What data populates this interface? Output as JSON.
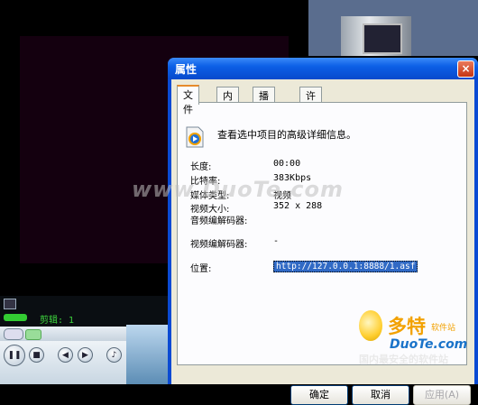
{
  "dialog": {
    "title": "属性",
    "close": "×",
    "tabs": [
      "文件",
      "内容",
      "播放列表",
      "许可证"
    ],
    "heading": "查看选中项目的高级详细信息。",
    "fields": [
      {
        "label": "长度:",
        "value": "00:00"
      },
      {
        "label": "比特率:",
        "value": "383Kbps"
      },
      {
        "label": "媒体类型:",
        "value": "视频"
      },
      {
        "label": "视频大小:",
        "value": "352 x 288"
      },
      {
        "label": "音频编解码器:",
        "value": ""
      },
      {
        "label": "视频编解码器:",
        "value": "-"
      },
      {
        "label": "位置:",
        "value": "http://127.0.0.1:8888/1.asf"
      }
    ],
    "buttons": {
      "ok": "确定",
      "cancel": "取消",
      "apply": "应用(A)"
    }
  },
  "player": {
    "clip_label": "剪辑: 1"
  },
  "watermark": "www.DuoTe.com",
  "logo": {
    "brand": "多特",
    "sub": "软件站",
    "url": "DuoTe.com",
    "slogan": "国内最安全的软件站"
  }
}
